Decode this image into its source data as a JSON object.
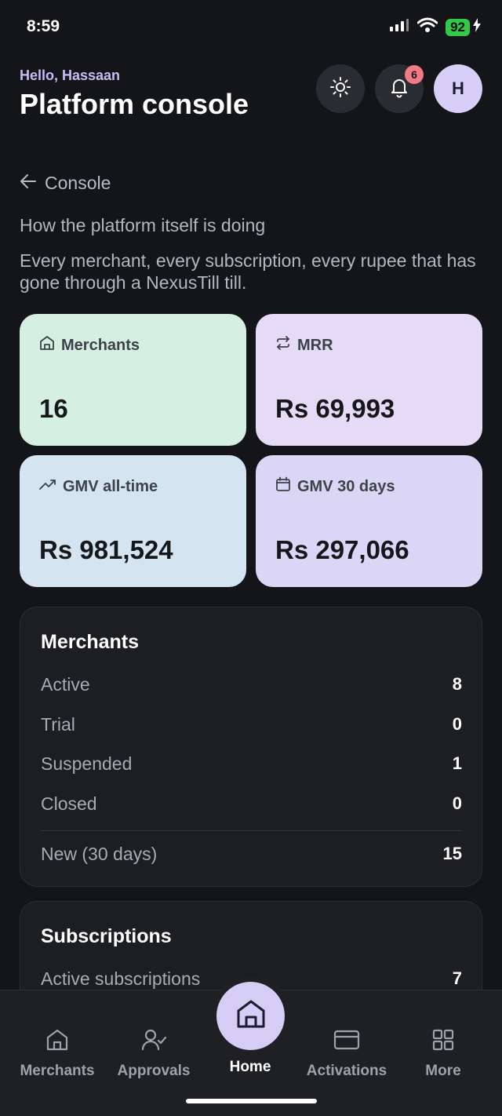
{
  "status_bar": {
    "time": "8:59",
    "battery": "92"
  },
  "header": {
    "greeting": "Hello, Hassaan",
    "title": "Platform console",
    "notification_count": "6",
    "avatar_initial": "H"
  },
  "breadcrumb": {
    "back_label": "Console"
  },
  "intro": {
    "subtitle": "How the platform itself is doing",
    "description": "Every merchant, every subscription, every rupee that has gone through a NexusTill till."
  },
  "stats": [
    {
      "label": "Merchants",
      "value": "16",
      "icon": "store-icon"
    },
    {
      "label": "MRR",
      "value": "Rs 69,993",
      "icon": "repeat-icon"
    },
    {
      "label": "GMV all-time",
      "value": "Rs 981,524",
      "icon": "trending-up-icon"
    },
    {
      "label": "GMV 30 days",
      "value": "Rs 297,066",
      "icon": "calendar-icon"
    }
  ],
  "merchants_panel": {
    "title": "Merchants",
    "rows": [
      {
        "label": "Active",
        "value": "8"
      },
      {
        "label": "Trial",
        "value": "0"
      },
      {
        "label": "Suspended",
        "value": "1"
      },
      {
        "label": "Closed",
        "value": "0"
      },
      {
        "label": "New (30 days)",
        "value": "15"
      }
    ]
  },
  "subscriptions_panel": {
    "title": "Subscriptions",
    "rows": [
      {
        "label": "Active subscriptions",
        "value": "7"
      }
    ]
  },
  "bottom_nav": {
    "items": [
      {
        "label": "Merchants",
        "icon": "store-icon"
      },
      {
        "label": "Approvals",
        "icon": "user-check-icon"
      },
      {
        "label": "Home",
        "icon": "home-icon",
        "active": true
      },
      {
        "label": "Activations",
        "icon": "card-icon"
      },
      {
        "label": "More",
        "icon": "grid-icon"
      }
    ]
  },
  "colors": {
    "background": "#141519",
    "accent": "#d6cdf6",
    "card_merchants": "#d5efe3",
    "card_mrr": "#e5dbf7",
    "card_gmv_all": "#d4e4f1",
    "card_gmv_30": "#dcd6f6",
    "badge": "#f07a86"
  }
}
